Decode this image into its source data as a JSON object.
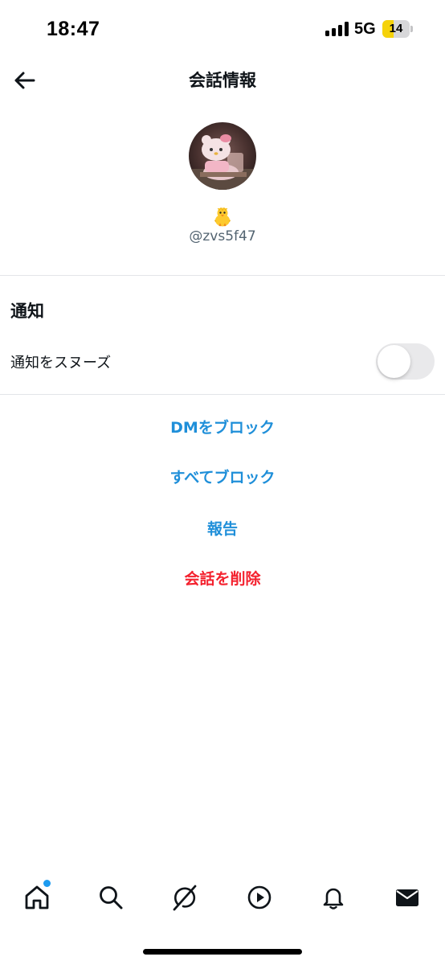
{
  "status_bar": {
    "time": "18:47",
    "network": "5G",
    "battery_level": "14",
    "battery_fraction": 0.14,
    "battery_fill_color": "#f5d20a"
  },
  "header": {
    "title": "会話情報",
    "back_icon": "arrow-left-icon"
  },
  "profile": {
    "display_name_emoji": "chick-emoji",
    "handle": "@zvs5f47",
    "avatar": "hello-kitty-avatar"
  },
  "notifications": {
    "section_title": "通知",
    "snooze_label": "通知をスヌーズ",
    "snooze_enabled": false
  },
  "actions": {
    "block_dm": "DMをブロック",
    "block_all": "すべてブロック",
    "report": "報告",
    "delete_conversation": "会話を削除"
  },
  "colors": {
    "link_blue": "#1f8fd9",
    "danger_red": "#f4212e",
    "notification_dot": "#1d9bf0"
  },
  "tabbar": {
    "tabs": [
      "home-icon",
      "search-icon",
      "grok-icon",
      "video-icon",
      "notifications-icon",
      "messages-icon"
    ],
    "home_has_badge": true,
    "active": "messages-icon"
  }
}
